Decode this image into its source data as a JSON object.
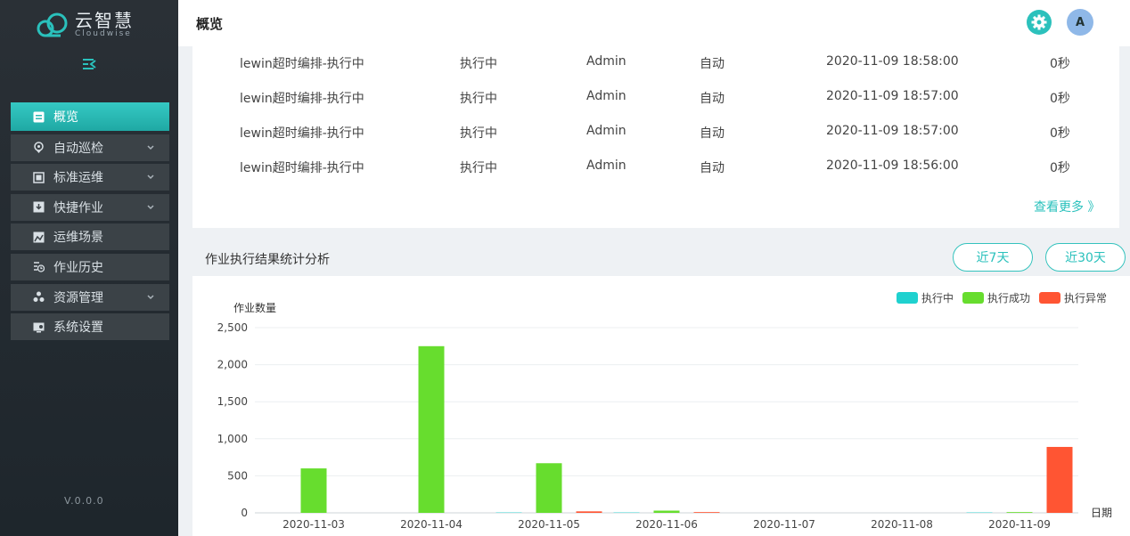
{
  "sidebar": {
    "logo_cn": "云智慧",
    "logo_en": "Cloudwise",
    "items": [
      {
        "label": "概览",
        "icon": "overview-icon",
        "active": true
      },
      {
        "label": "自动巡检",
        "icon": "inspection-icon",
        "expandable": true
      },
      {
        "label": "标准运维",
        "icon": "standard-ops-icon",
        "expandable": true
      },
      {
        "label": "快捷作业",
        "icon": "quick-job-icon",
        "expandable": true
      },
      {
        "label": "运维场景",
        "icon": "scene-icon"
      },
      {
        "label": "作业历史",
        "icon": "history-icon"
      },
      {
        "label": "资源管理",
        "icon": "resource-icon",
        "expandable": true
      },
      {
        "label": "系统设置",
        "icon": "settings-icon"
      }
    ],
    "footer": "V.0.0.0"
  },
  "header": {
    "title": "概览",
    "avatar_letter": "A"
  },
  "jobs_table": {
    "rows": [
      {
        "name": "lewin超时编排-执行中",
        "status": "执行中",
        "user": "Admin",
        "mode": "自动",
        "time": "2020-11-09 18:58:00",
        "duration": "0秒"
      },
      {
        "name": "lewin超时编排-执行中",
        "status": "执行中",
        "user": "Admin",
        "mode": "自动",
        "time": "2020-11-09 18:57:00",
        "duration": "0秒"
      },
      {
        "name": "lewin超时编排-执行中",
        "status": "执行中",
        "user": "Admin",
        "mode": "自动",
        "time": "2020-11-09 18:57:00",
        "duration": "0秒"
      },
      {
        "name": "lewin超时编排-执行中",
        "status": "执行中",
        "user": "Admin",
        "mode": "自动",
        "time": "2020-11-09 18:56:00",
        "duration": "0秒"
      }
    ],
    "see_more": "查看更多 》"
  },
  "stats": {
    "title": "作业执行结果统计分析",
    "btn_7": "近7天",
    "btn_30": "近30天"
  },
  "colors": {
    "accent": "#2ac1bc",
    "running": "#1fd1cf",
    "success": "#67dd2e",
    "error": "#ff5533"
  },
  "chart_data": {
    "type": "bar",
    "ylabel": "作业数量",
    "xlabel": "日期",
    "ylim": [
      0,
      2500
    ],
    "yticks": [
      0,
      500,
      1000,
      1500,
      2000,
      2500
    ],
    "ytick_labels": [
      "0",
      "500",
      "1,000",
      "1,500",
      "2,000",
      "2,500"
    ],
    "categories": [
      "2020-11-03",
      "2020-11-04",
      "2020-11-05",
      "2020-11-06",
      "2020-11-07",
      "2020-11-08",
      "2020-11-09"
    ],
    "series": [
      {
        "name": "执行中",
        "color": "#1fd1cf",
        "values": [
          0,
          0,
          5,
          5,
          0,
          0,
          5
        ]
      },
      {
        "name": "执行成功",
        "color": "#67dd2e",
        "values": [
          600,
          2250,
          670,
          30,
          0,
          0,
          10
        ]
      },
      {
        "name": "执行异常",
        "color": "#ff5533",
        "values": [
          0,
          0,
          20,
          10,
          0,
          0,
          890
        ]
      }
    ],
    "legend_position": "top-right",
    "grid": true
  }
}
